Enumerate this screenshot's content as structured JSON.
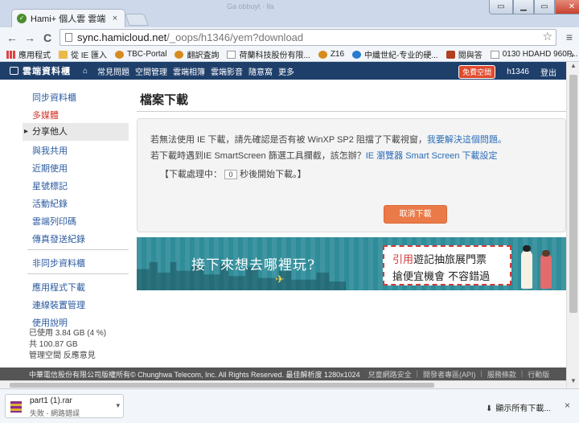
{
  "browser": {
    "tab_title": "Hami+ 個人雲 雲端資料櫃",
    "tab_close": "×",
    "blurred_title": "Ga obbuyt   ·   lla",
    "url_host": "sync.hamicloud.net",
    "url_path": "/_oops/h1346/yem?download",
    "back": "←",
    "forward": "→",
    "reload": "C",
    "star": "☆",
    "menu": "≡",
    "bookmarks": [
      {
        "label": "應用程式",
        "icon": "apps-icon"
      },
      {
        "label": "從 IE 匯入",
        "icon": "folder-icon"
      },
      {
        "label": "TBC-Portal",
        "icon": "gear-icon"
      },
      {
        "label": "翻訳査詢",
        "icon": "gear-icon"
      },
      {
        "label": "荷蘭科技股份有限...",
        "icon": "doc-icon"
      },
      {
        "label": "Z16",
        "icon": "gear-icon"
      },
      {
        "label": "中纖世紀-专业的硬...",
        "icon": "ie-icon"
      },
      {
        "label": "閱與答",
        "icon": "wolf-icon"
      },
      {
        "label": "0130 HDAHD 960P...",
        "icon": "doc-icon"
      }
    ],
    "bookmarks_more": "»"
  },
  "site": {
    "logo_text": "雲端資料櫃",
    "nav_links": [
      "常見問題",
      "空間管理",
      "雲端相簿",
      "雲端影音",
      "隨意窩",
      "更多"
    ],
    "upgrade_badge": "免費空間",
    "username": "h1346",
    "logout": "登出"
  },
  "sidebar": {
    "items": [
      {
        "label": "同步資料櫃",
        "style": "link"
      },
      {
        "label": "多媒體",
        "style": "red"
      },
      {
        "label": "分享他人",
        "style": "selected"
      },
      {
        "label": "與我共用",
        "style": "link"
      },
      {
        "label": "近期使用",
        "style": "link"
      },
      {
        "label": "星號標記",
        "style": "link"
      },
      {
        "label": "活動紀錄",
        "style": "link"
      },
      {
        "label": "雲端列印碼",
        "style": "link"
      },
      {
        "label": "傳真發送紀錄",
        "style": "link"
      }
    ],
    "items2": [
      {
        "label": "非同步資料櫃"
      },
      {
        "label": "應用程式下載"
      },
      {
        "label": "連線裝置管理"
      },
      {
        "label": "使用說明"
      }
    ],
    "usage_used": "已使用 3.84 GB (4 %)",
    "usage_total": "共 100.87 GB",
    "manage_space": "管理空間",
    "feedback": "反應意見"
  },
  "main": {
    "title": "檔案下載",
    "line1_text": "若無法使用 IE 下載，請先確認是否有被 WinXP SP2 阻擋了下載視窗，",
    "line1_link": "我要解決這個問題。",
    "line2_text": "若下載時遇到IE SmartScreen 篩選工具攔截，該怎辦？",
    "line2_link": "IE 瀏覽器 Smart Screen 下載設定",
    "countdown_prefix": "【下載處理中：",
    "countdown_value": "0",
    "countdown_suffix": "秒後開始下載。】",
    "cancel_button": "取消下載"
  },
  "banner": {
    "slogan": "接下來想去哪裡玩?",
    "ticket_hl": "引用",
    "ticket_line1_rest": "遊記抽旅展門票",
    "ticket_line2": "搶便宜機會 不容錯過"
  },
  "footer": {
    "copyright": "中華電信股份有限公司版權所有© Chunghwa Telecom, Inc. All Rights Reserved. 最佳解析度 1280x1024",
    "links": [
      "兒童網路安全",
      "開發者專區(API)",
      "服務條款",
      "行動版"
    ]
  },
  "download_shelf": {
    "file_name": "part1 (1).rar",
    "status": "失敗 - 網路錯誤",
    "show_all": "顯示所有下載...",
    "close": "×"
  }
}
